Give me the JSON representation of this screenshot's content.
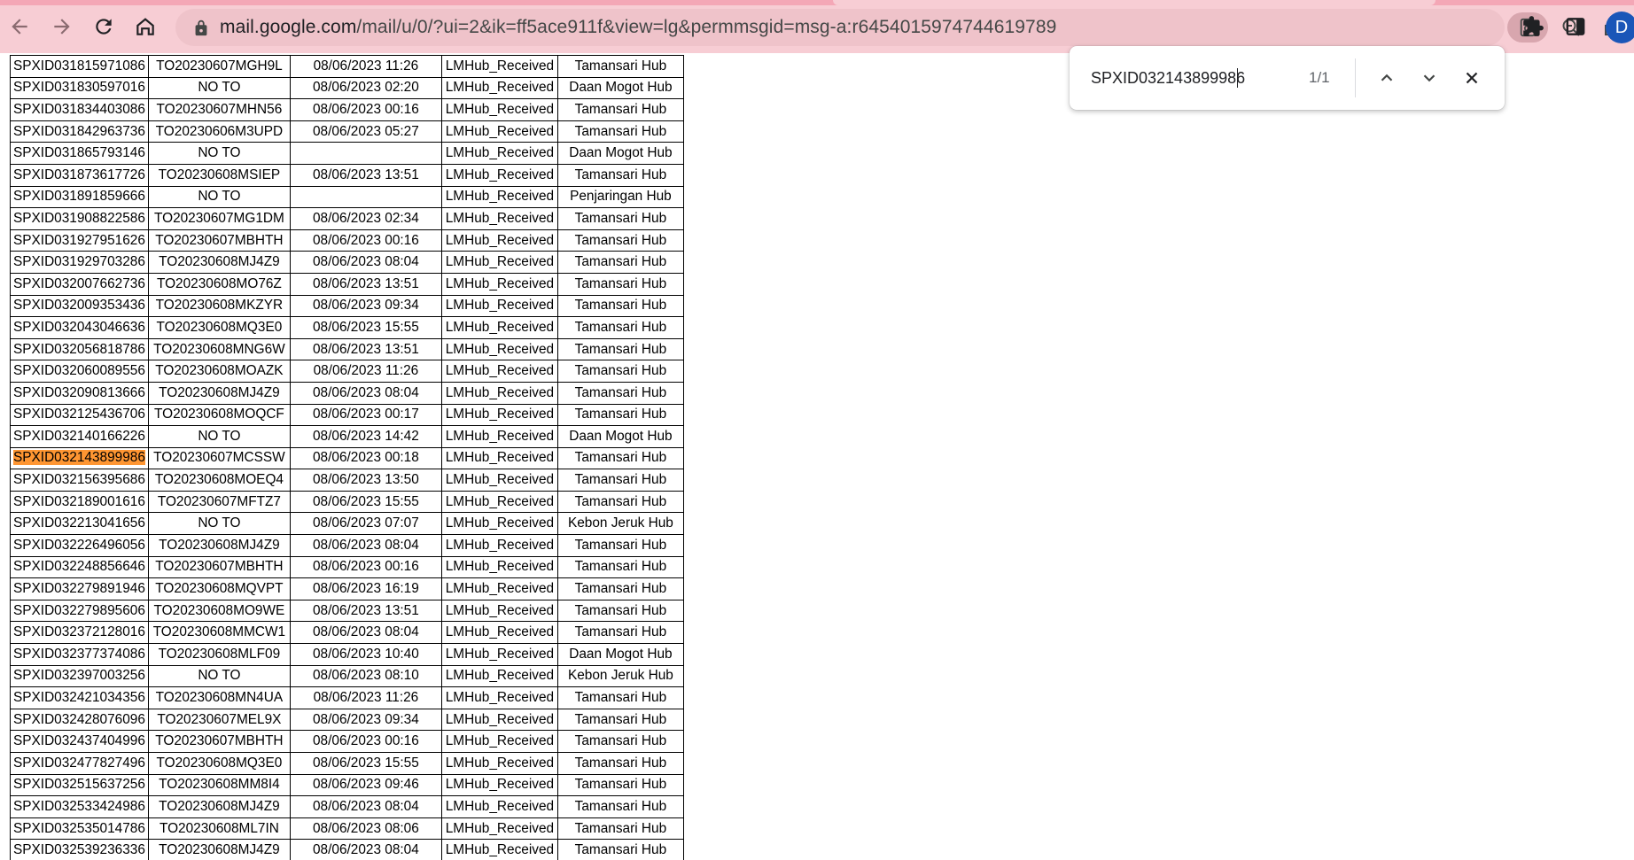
{
  "browser": {
    "url_host": "mail.google.com",
    "url_path": "/mail/u/0/?ui=2&ik=ff5ace911f&view=lg&permmsgid=msg-a:r6454015974744619789",
    "avatar_letter": "D",
    "icons": [
      "back-icon",
      "forward-icon",
      "reload-icon",
      "home-icon",
      "lock-icon",
      "find-in-page-icon",
      "zoom-icon",
      "share-icon",
      "bookmark-star-icon",
      "extensions-icon",
      "side-panel-icon"
    ]
  },
  "find_bar": {
    "query": "SPXID032143899986",
    "match_count": "1/1"
  },
  "highlight": {
    "color": "#ff9632",
    "row_index": 18
  },
  "table": {
    "rows": [
      [
        "SPXID031815971086",
        "TO20230607MGH9L",
        "08/06/2023 11:26",
        "LMHub_Received",
        "Tamansari Hub"
      ],
      [
        "SPXID031830597016",
        "NO TO",
        "08/06/2023 02:20",
        "LMHub_Received",
        "Daan Mogot Hub"
      ],
      [
        "SPXID031834403086",
        "TO20230607MHN56",
        "08/06/2023 00:16",
        "LMHub_Received",
        "Tamansari Hub"
      ],
      [
        "SPXID031842963736",
        "TO20230606M3UPD",
        "08/06/2023 05:27",
        "LMHub_Received",
        "Tamansari Hub"
      ],
      [
        "SPXID031865793146",
        "NO TO",
        "",
        "LMHub_Received",
        "Daan Mogot Hub"
      ],
      [
        "SPXID031873617726",
        "TO20230608MSIEP",
        "08/06/2023 13:51",
        "LMHub_Received",
        "Tamansari Hub"
      ],
      [
        "SPXID031891859666",
        "NO TO",
        "",
        "LMHub_Received",
        "Penjaringan Hub"
      ],
      [
        "SPXID031908822586",
        "TO20230607MG1DM",
        "08/06/2023 02:34",
        "LMHub_Received",
        "Tamansari Hub"
      ],
      [
        "SPXID031927951626",
        "TO20230607MBHTH",
        "08/06/2023 00:16",
        "LMHub_Received",
        "Tamansari Hub"
      ],
      [
        "SPXID031929703286",
        "TO20230608MJ4Z9",
        "08/06/2023 08:04",
        "LMHub_Received",
        "Tamansari Hub"
      ],
      [
        "SPXID032007662736",
        "TO20230608MO76Z",
        "08/06/2023 13:51",
        "LMHub_Received",
        "Tamansari Hub"
      ],
      [
        "SPXID032009353436",
        "TO20230608MKZYR",
        "08/06/2023 09:34",
        "LMHub_Received",
        "Tamansari Hub"
      ],
      [
        "SPXID032043046636",
        "TO20230608MQ3E0",
        "08/06/2023 15:55",
        "LMHub_Received",
        "Tamansari Hub"
      ],
      [
        "SPXID032056818786",
        "TO20230608MNG6W",
        "08/06/2023 13:51",
        "LMHub_Received",
        "Tamansari Hub"
      ],
      [
        "SPXID032060089556",
        "TO20230608MOAZK",
        "08/06/2023 11:26",
        "LMHub_Received",
        "Tamansari Hub"
      ],
      [
        "SPXID032090813666",
        "TO20230608MJ4Z9",
        "08/06/2023 08:04",
        "LMHub_Received",
        "Tamansari Hub"
      ],
      [
        "SPXID032125436706",
        "TO20230608MOQCF",
        "08/06/2023 00:17",
        "LMHub_Received",
        "Tamansari Hub"
      ],
      [
        "SPXID032140166226",
        "NO TO",
        "08/06/2023 14:42",
        "LMHub_Received",
        "Daan Mogot Hub"
      ],
      [
        "SPXID032143899986",
        "TO20230607MCSSW",
        "08/06/2023 00:18",
        "LMHub_Received",
        "Tamansari Hub"
      ],
      [
        "SPXID032156395686",
        "TO20230608MOEQ4",
        "08/06/2023 13:50",
        "LMHub_Received",
        "Tamansari Hub"
      ],
      [
        "SPXID032189001616",
        "TO20230607MFTZ7",
        "08/06/2023 15:55",
        "LMHub_Received",
        "Tamansari Hub"
      ],
      [
        "SPXID032213041656",
        "NO TO",
        "08/06/2023 07:07",
        "LMHub_Received",
        "Kebon Jeruk Hub"
      ],
      [
        "SPXID032226496056",
        "TO20230608MJ4Z9",
        "08/06/2023 08:04",
        "LMHub_Received",
        "Tamansari Hub"
      ],
      [
        "SPXID032248856646",
        "TO20230607MBHTH",
        "08/06/2023 00:16",
        "LMHub_Received",
        "Tamansari Hub"
      ],
      [
        "SPXID032279891946",
        "TO20230608MQVPT",
        "08/06/2023 16:19",
        "LMHub_Received",
        "Tamansari Hub"
      ],
      [
        "SPXID032279895606",
        "TO20230608MO9WE",
        "08/06/2023 13:51",
        "LMHub_Received",
        "Tamansari Hub"
      ],
      [
        "SPXID032372128016",
        "TO20230608MMCW1",
        "08/06/2023 08:04",
        "LMHub_Received",
        "Tamansari Hub"
      ],
      [
        "SPXID032377374086",
        "TO20230608MLF09",
        "08/06/2023 10:40",
        "LMHub_Received",
        "Daan Mogot Hub"
      ],
      [
        "SPXID032397003256",
        "NO TO",
        "08/06/2023 08:10",
        "LMHub_Received",
        "Kebon Jeruk Hub"
      ],
      [
        "SPXID032421034356",
        "TO20230608MN4UA",
        "08/06/2023 11:26",
        "LMHub_Received",
        "Tamansari Hub"
      ],
      [
        "SPXID032428076096",
        "TO20230607MEL9X",
        "08/06/2023 09:34",
        "LMHub_Received",
        "Tamansari Hub"
      ],
      [
        "SPXID032437404996",
        "TO20230607MBHTH",
        "08/06/2023 00:16",
        "LMHub_Received",
        "Tamansari Hub"
      ],
      [
        "SPXID032477827496",
        "TO20230608MQ3E0",
        "08/06/2023 15:55",
        "LMHub_Received",
        "Tamansari Hub"
      ],
      [
        "SPXID032515637256",
        "TO20230608MM8I4",
        "08/06/2023 09:46",
        "LMHub_Received",
        "Tamansari Hub"
      ],
      [
        "SPXID032533424986",
        "TO20230608MJ4Z9",
        "08/06/2023 08:04",
        "LMHub_Received",
        "Tamansari Hub"
      ],
      [
        "SPXID032535014786",
        "TO20230608ML7IN",
        "08/06/2023 08:06",
        "LMHub_Received",
        "Tamansari Hub"
      ],
      [
        "SPXID032539236336",
        "TO20230608MJ4Z9",
        "08/06/2023 08:04",
        "LMHub_Received",
        "Tamansari Hub"
      ]
    ]
  }
}
